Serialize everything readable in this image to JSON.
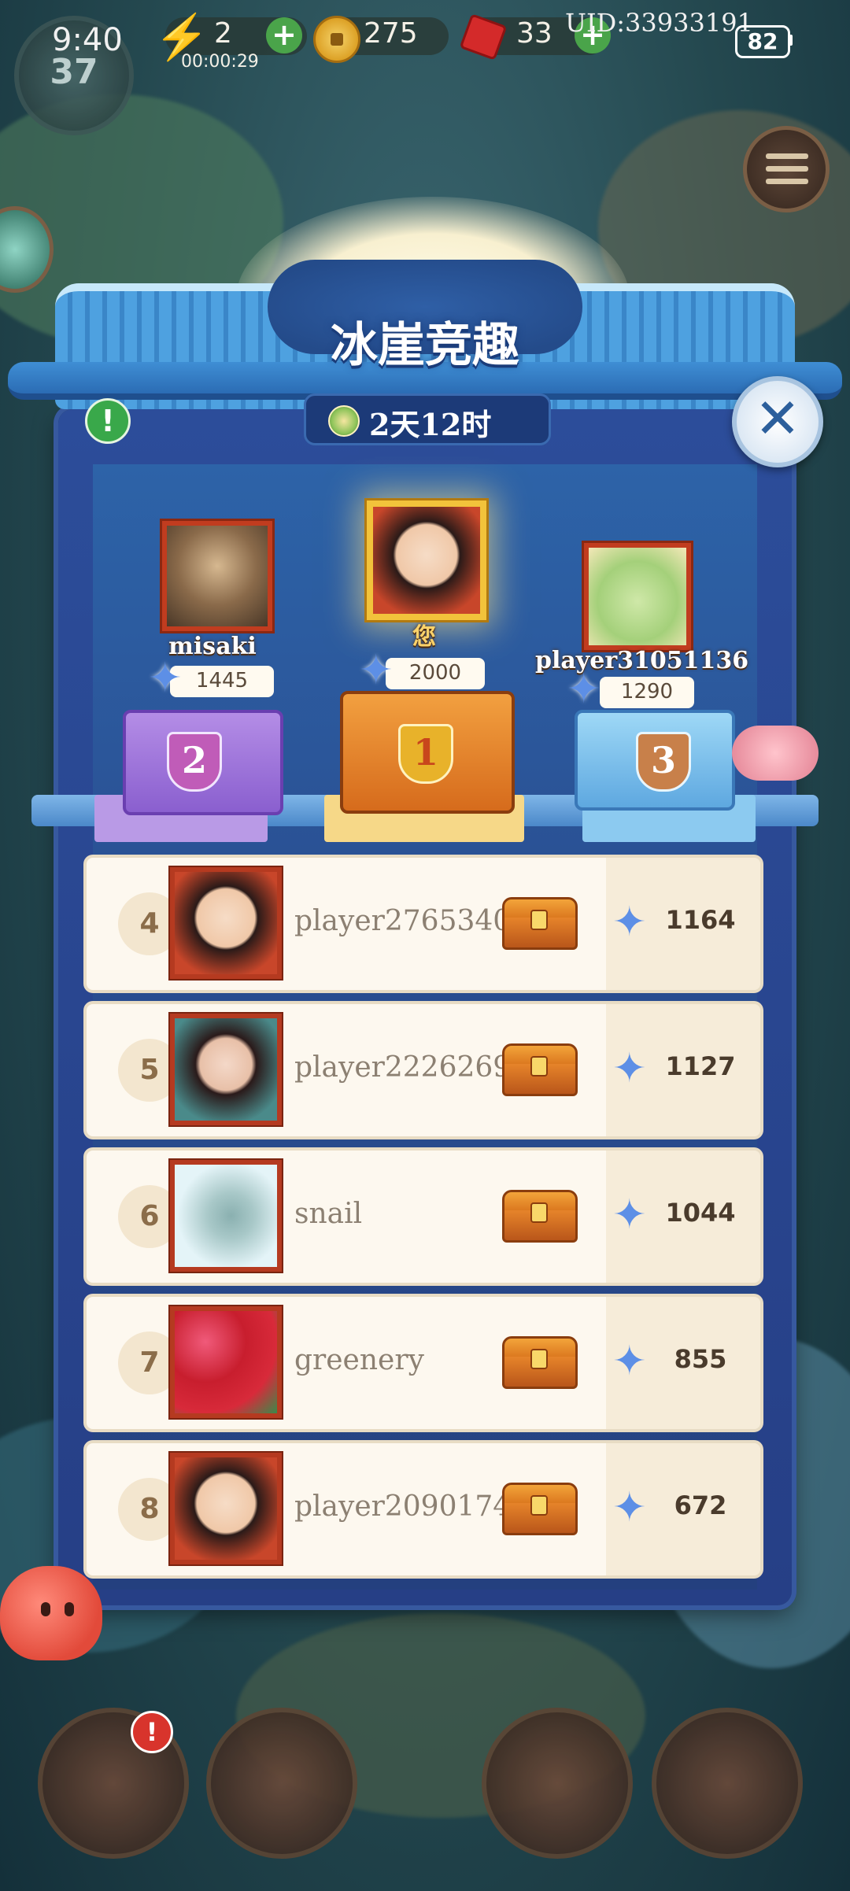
{
  "status_bar": {
    "time": "9:40",
    "battery": "82",
    "uid": "UID:33933191"
  },
  "resources": {
    "level": "37",
    "energy": "2",
    "energy_timer": "00:00:29",
    "coins": "275",
    "gems": "33"
  },
  "panel": {
    "title": "冰崖竞趣",
    "timer": "2天12时"
  },
  "podium": [
    {
      "rank": "1",
      "name": "您",
      "score": "2000"
    },
    {
      "rank": "2",
      "name": "misaki",
      "score": "1445"
    },
    {
      "rank": "3",
      "name": "player31051136",
      "score": "1290"
    }
  ],
  "leaderboard": [
    {
      "rank": "4",
      "name": "player27653405",
      "score": "1164"
    },
    {
      "rank": "5",
      "name": "player22262694",
      "score": "1127"
    },
    {
      "rank": "6",
      "name": "snail",
      "score": "1044"
    },
    {
      "rank": "7",
      "name": "greenery",
      "score": "855"
    },
    {
      "rank": "8",
      "name": "player20901741",
      "score": "672"
    }
  ],
  "colors": {
    "panel_blue": "#2c4d9a",
    "gold": "#f2c33b",
    "silver_purple": "#9c78d8",
    "bronze_blue": "#6cb4e8",
    "row_bg": "#fdf8ef",
    "star_blue": "#5d8fe6"
  }
}
